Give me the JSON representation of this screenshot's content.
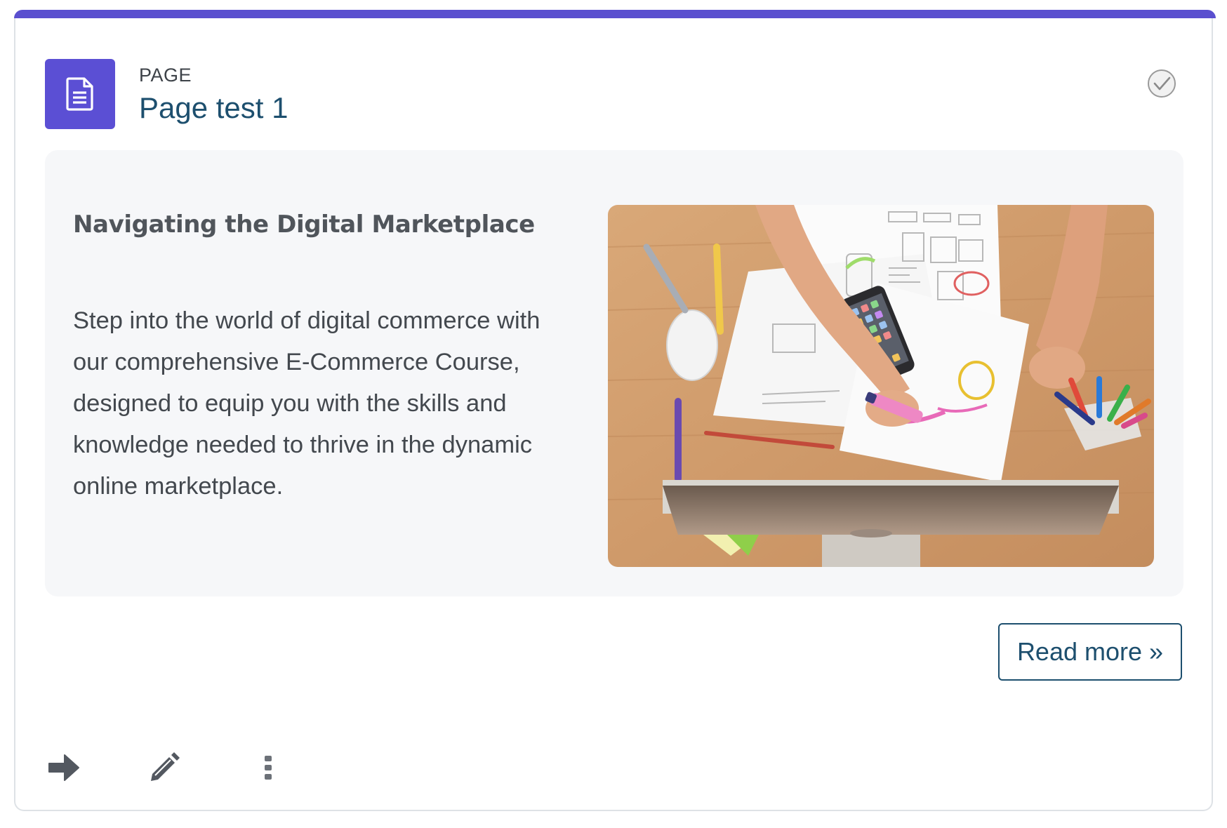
{
  "activity": {
    "type_label": "PAGE",
    "title": "Page test 1",
    "icon": "page-document-icon",
    "completion_icon": "check-circle-icon"
  },
  "content": {
    "heading": "Navigating the Digital Marketplace",
    "body": "Step into the world of digital commerce with our comprehensive E-Commerce Course, designed to equip you with the skills and knowledge needed to thrive in the dynamic online marketplace.",
    "image": "workspace-desk-photo"
  },
  "read_more_label": "Read more »",
  "footer_actions": [
    {
      "icon": "arrow-right-icon"
    },
    {
      "icon": "pencil-icon"
    },
    {
      "icon": "kebab-menu-icon"
    }
  ],
  "colors": {
    "accent": "#5a4fcf",
    "link": "#1d4f6e",
    "content_bg": "#f6f7f9"
  }
}
